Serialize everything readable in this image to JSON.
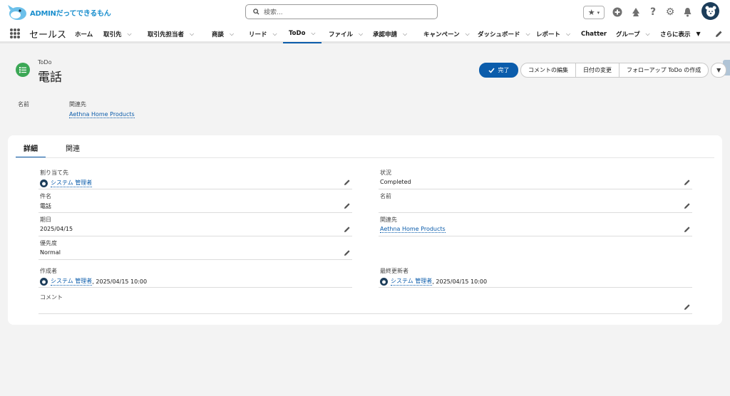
{
  "header": {
    "logo_text": "ADMINだってできるもん",
    "search_placeholder": "検索..."
  },
  "nav": {
    "app_name": "セールス",
    "items": [
      {
        "label": "ホーム",
        "dropdown": false
      },
      {
        "label": "取引先",
        "dropdown": true
      },
      {
        "label": "取引先担当者",
        "dropdown": true
      },
      {
        "label": "商談",
        "dropdown": true
      },
      {
        "label": "リード",
        "dropdown": true
      },
      {
        "label": "ToDo",
        "dropdown": true,
        "active": true
      },
      {
        "label": "ファイル",
        "dropdown": true
      },
      {
        "label": "承認申請",
        "dropdown": true
      },
      {
        "label": "キャンペーン",
        "dropdown": true
      },
      {
        "label": "ダッシュボード",
        "dropdown": true
      },
      {
        "label": "レポート",
        "dropdown": true
      },
      {
        "label": "Chatter",
        "dropdown": false
      },
      {
        "label": "グループ",
        "dropdown": true
      }
    ],
    "more_label": "さらに表示"
  },
  "record": {
    "object_label": "ToDo",
    "title": "電話",
    "buttons": {
      "done": "完了",
      "edit_comment": "コメントの編集",
      "change_date": "日付の変更",
      "create_followup": "フォローアップ ToDo の作成"
    },
    "highlights": {
      "name_label": "名前",
      "related_label": "関連先",
      "related_value": "Aethna Home Products"
    }
  },
  "tabs": {
    "details": "詳細",
    "related": "関連"
  },
  "fields": {
    "assigned_to": {
      "label": "割り当て先",
      "value": "システム 管理者"
    },
    "status": {
      "label": "状況",
      "value": "Completed"
    },
    "subject": {
      "label": "件名",
      "value": "電話"
    },
    "name": {
      "label": "名前",
      "value": ""
    },
    "due_date": {
      "label": "期日",
      "value": "2025/04/15"
    },
    "related_to": {
      "label": "関連先",
      "value": "Aethna Home Products"
    },
    "priority": {
      "label": "優先度",
      "value": "Normal"
    },
    "created_by": {
      "label": "作成者",
      "user": "システム 管理者",
      "date": ", 2025/04/15 10:00"
    },
    "modified_by": {
      "label": "最終更新者",
      "user": "システム 管理者",
      "date": ", 2025/04/15 10:00"
    },
    "comment": {
      "label": "コメント",
      "value": ""
    }
  },
  "colors": {
    "brand": "#0b5cab",
    "todo_icon": "#3ba755"
  }
}
